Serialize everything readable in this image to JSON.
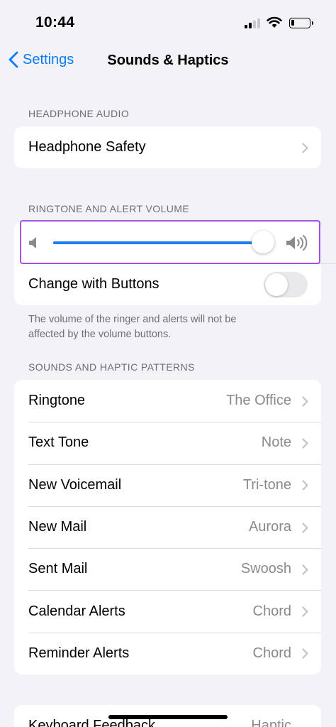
{
  "status_bar": {
    "time": "10:44",
    "battery_percent": 20
  },
  "nav": {
    "back_label": "Settings",
    "title": "Sounds & Haptics"
  },
  "headphone_audio": {
    "header": "HEADPHONE AUDIO",
    "items": [
      {
        "label": "Headphone Safety"
      }
    ]
  },
  "ringtone_volume": {
    "header": "RINGTONE AND ALERT VOLUME",
    "slider_level_percent": 100,
    "change_with_buttons_label": "Change with Buttons",
    "change_with_buttons_on": false,
    "help_text_line1": "The volume of the ringer and alerts will not be",
    "help_text_line2": "affected by the volume buttons."
  },
  "sound_patterns": {
    "header": "SOUNDS AND HAPTIC PATTERNS",
    "items": [
      {
        "label": "Ringtone",
        "value": "The Office"
      },
      {
        "label": "Text Tone",
        "value": "Note"
      },
      {
        "label": "New Voicemail",
        "value": "Tri-tone"
      },
      {
        "label": "New Mail",
        "value": "Aurora"
      },
      {
        "label": "Sent Mail",
        "value": "Swoosh"
      },
      {
        "label": "Calendar Alerts",
        "value": "Chord"
      },
      {
        "label": "Reminder Alerts",
        "value": "Chord"
      }
    ]
  },
  "next_group": {
    "label": "Keyboard Feedback",
    "value": "Haptic"
  },
  "colors": {
    "accent": "#0a7aff",
    "slider_fill": "#1a7cf0",
    "highlight_border": "#a64ee3"
  },
  "icons": [
    "chevron-left-icon",
    "chevron-right-icon",
    "speaker-low-icon",
    "speaker-high-icon",
    "wifi-icon",
    "cellular-signal-icon",
    "battery-icon"
  ]
}
